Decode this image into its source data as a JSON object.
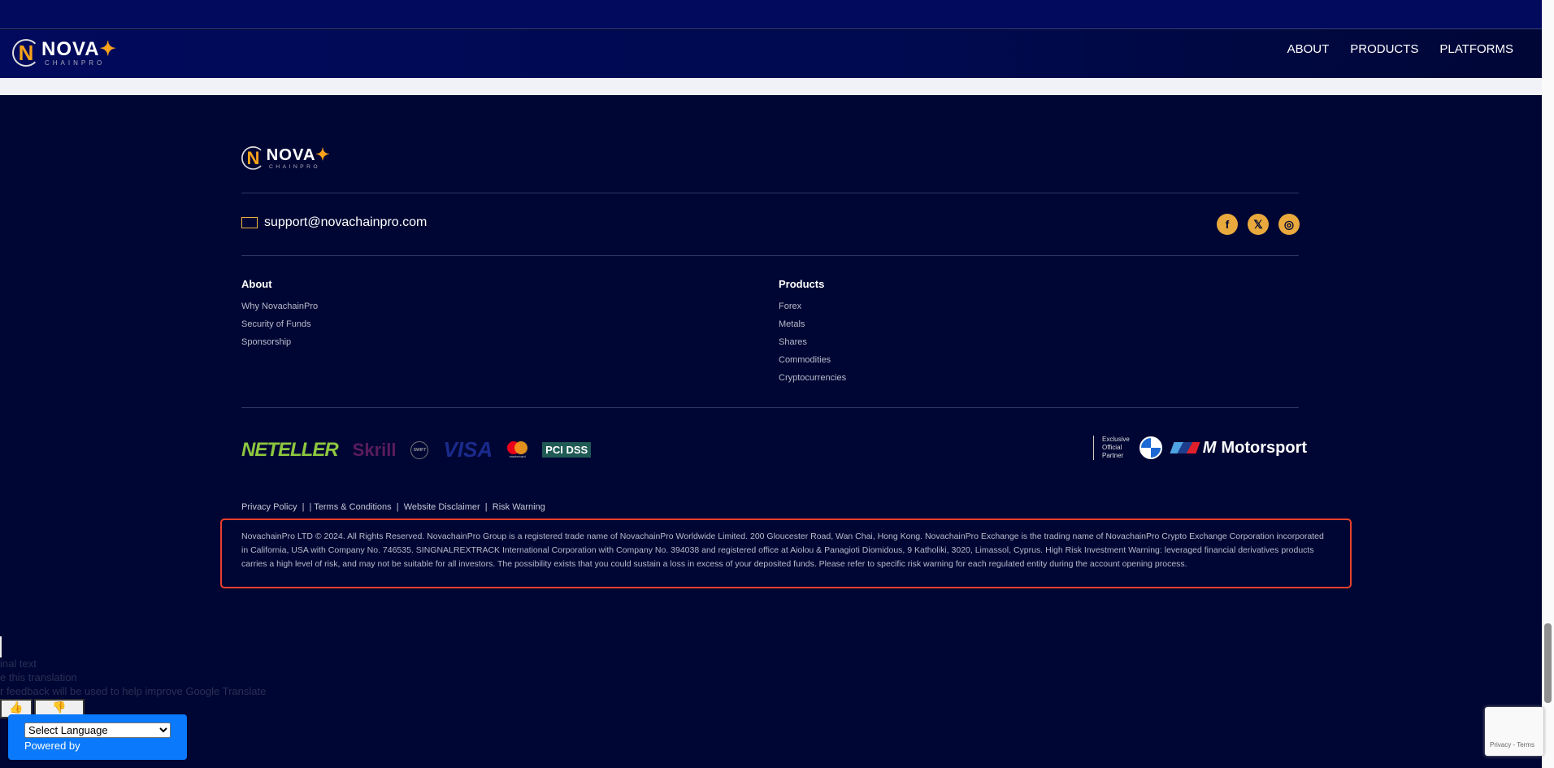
{
  "header": {
    "logo_main": "NOVA",
    "logo_sub": "CHAINPRO",
    "nav": [
      "ABOUT",
      "PRODUCTS",
      "PLATFORMS"
    ]
  },
  "footer": {
    "email": "support@novachainpro.com",
    "socials": [
      "facebook-icon",
      "x-twitter-icon",
      "instagram-icon"
    ],
    "about": {
      "title": "About",
      "links": [
        "Why NovachainPro",
        "Security of Funds",
        "Sponsorship"
      ]
    },
    "products": {
      "title": "Products",
      "links": [
        "Forex",
        "Metals",
        "Shares",
        "Commodities",
        "Cryptocurrencies"
      ]
    },
    "payments": [
      "NETELLER",
      "Skrill",
      "SWIFT",
      "VISA",
      "mastercard",
      "PCI DSS"
    ],
    "partner": {
      "label1": "Exclusive",
      "label2": "Official",
      "label3": "Partner",
      "brand": "Motorsport"
    },
    "legal_links": [
      "Privacy Policy",
      "Terms & Conditions",
      "Website Disclaimer",
      "Risk Warning"
    ],
    "disclaimer": "NovachainPro LTD © 2024. All Rights Reserved. NovachainPro Group is a registered trade name of NovachainPro Worldwide Limited. 200 Gloucester Road, Wan Chai, Hong Kong. NovachainPro Exchange is the trading name of NovachainPro Crypto Exchange Corporation incorporated in California, USA with Company No. 746535. SINGNALREXTRACK International Corporation with Company No. 394038 and registered office at Aiolou & Panagioti Diomidous, 9 Katholiki, 3020, Limassol, Cyprus. High Risk Investment Warning: leveraged financial derivatives products carries a high level of risk, and may not be suitable for all investors. The possibility exists that you could sustain a loss in excess of your deposited funds. Please refer to specific risk warning for each regulated entity during the account opening process."
  },
  "translate": {
    "line1": "inal text",
    "line2": "e this translation",
    "line3": "r feedback will be used to help improve Google Translate",
    "select": "Select Language",
    "powered": "Powered by"
  },
  "recaptcha": "Privacy - Terms"
}
